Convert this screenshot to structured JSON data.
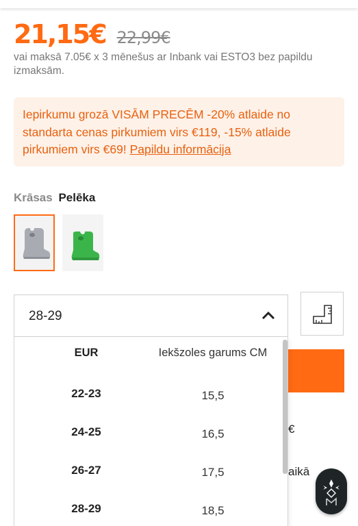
{
  "product": {
    "price_current": "21,15€",
    "price_old": "22,99€",
    "installment_text": "vai maksā 7.05€ x 3 mēnešus ar Inbank vai ESTO3 bez papildu izmaksām."
  },
  "promo": {
    "text": "Iepirkumu grozā VISĀM PRECĒM -20% atlaide no standarta cenas pirkumiem virs €119, -15% atlaide pirkumiem virs €69! ",
    "link_label": "Papildu informācija"
  },
  "colors": {
    "label": "Krāsas",
    "selected": "Pelēka",
    "swatches": [
      {
        "name": "grey-boot",
        "color": "#a9abb3"
      },
      {
        "name": "green-boot",
        "color": "#3bb54a"
      }
    ]
  },
  "size": {
    "selected_value": "28-29",
    "table_headers": [
      "EUR",
      "Iekšzoles garums CM"
    ],
    "rows": [
      {
        "eur": "22-23",
        "cm": "15,5"
      },
      {
        "eur": "24-25",
        "cm": "16,5"
      },
      {
        "eur": "26-27",
        "cm": "17,5"
      },
      {
        "eur": "28-29",
        "cm": "18,5"
      }
    ]
  },
  "partially_hidden": {
    "text1": "€",
    "text2": "aikā"
  },
  "accent_color": "#ff6a13"
}
